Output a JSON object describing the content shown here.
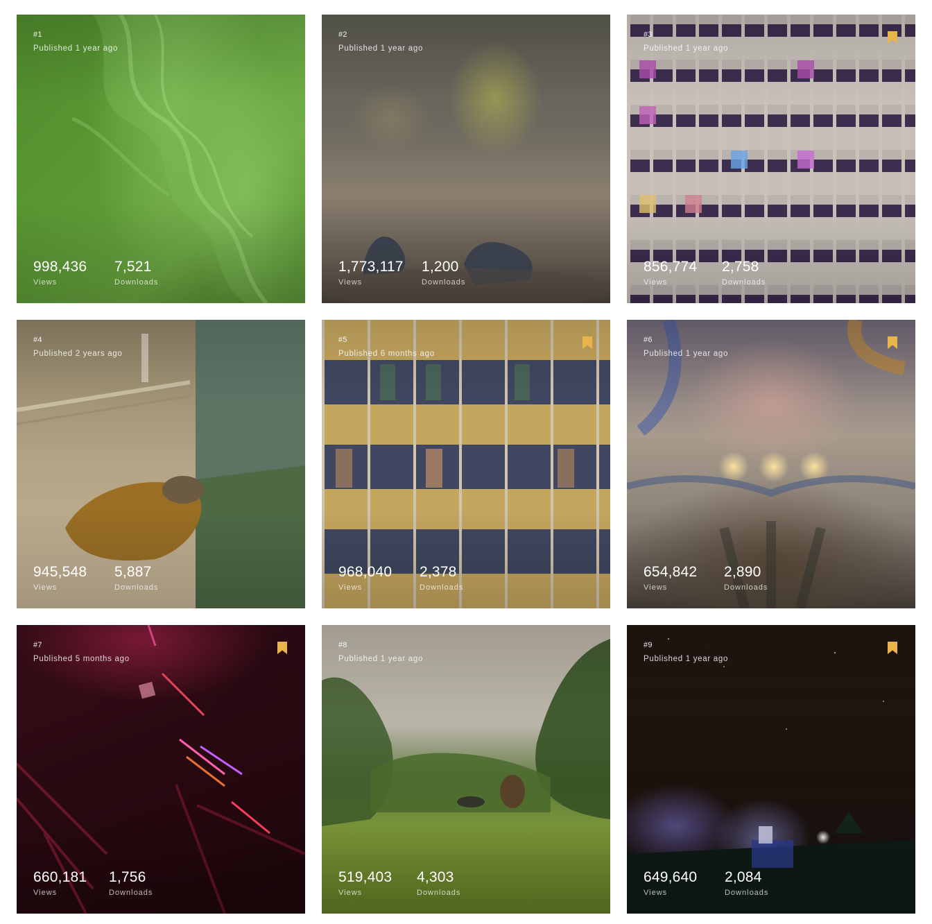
{
  "accent_color": "#e9b44c",
  "icons": {
    "bookmark": "bookmark-icon"
  },
  "stat_labels": {
    "views": "Views",
    "downloads": "Downloads"
  },
  "photos": [
    {
      "rank": "#1",
      "published": "Published 1 year ago",
      "views": "998,436",
      "downloads": "7,521",
      "bookmarked": false
    },
    {
      "rank": "#2",
      "published": "Published 1 year ago",
      "views": "1,773,117",
      "downloads": "1,200",
      "bookmarked": false
    },
    {
      "rank": "#3",
      "published": "Published 1 year ago",
      "views": "856,774",
      "downloads": "2,758",
      "bookmarked": true
    },
    {
      "rank": "#4",
      "published": "Published 2 years ago",
      "views": "945,548",
      "downloads": "5,887",
      "bookmarked": false
    },
    {
      "rank": "#5",
      "published": "Published 6 months ago",
      "views": "968,040",
      "downloads": "2,378",
      "bookmarked": true
    },
    {
      "rank": "#6",
      "published": "Published 1 year ago",
      "views": "654,842",
      "downloads": "2,890",
      "bookmarked": true
    },
    {
      "rank": "#7",
      "published": "Published 5 months ago",
      "views": "660,181",
      "downloads": "1,756",
      "bookmarked": true
    },
    {
      "rank": "#8",
      "published": "Published 1 year ago",
      "views": "519,403",
      "downloads": "4,303",
      "bookmarked": false
    },
    {
      "rank": "#9",
      "published": "Published 1 year ago",
      "views": "649,640",
      "downloads": "2,084",
      "bookmarked": true
    }
  ]
}
